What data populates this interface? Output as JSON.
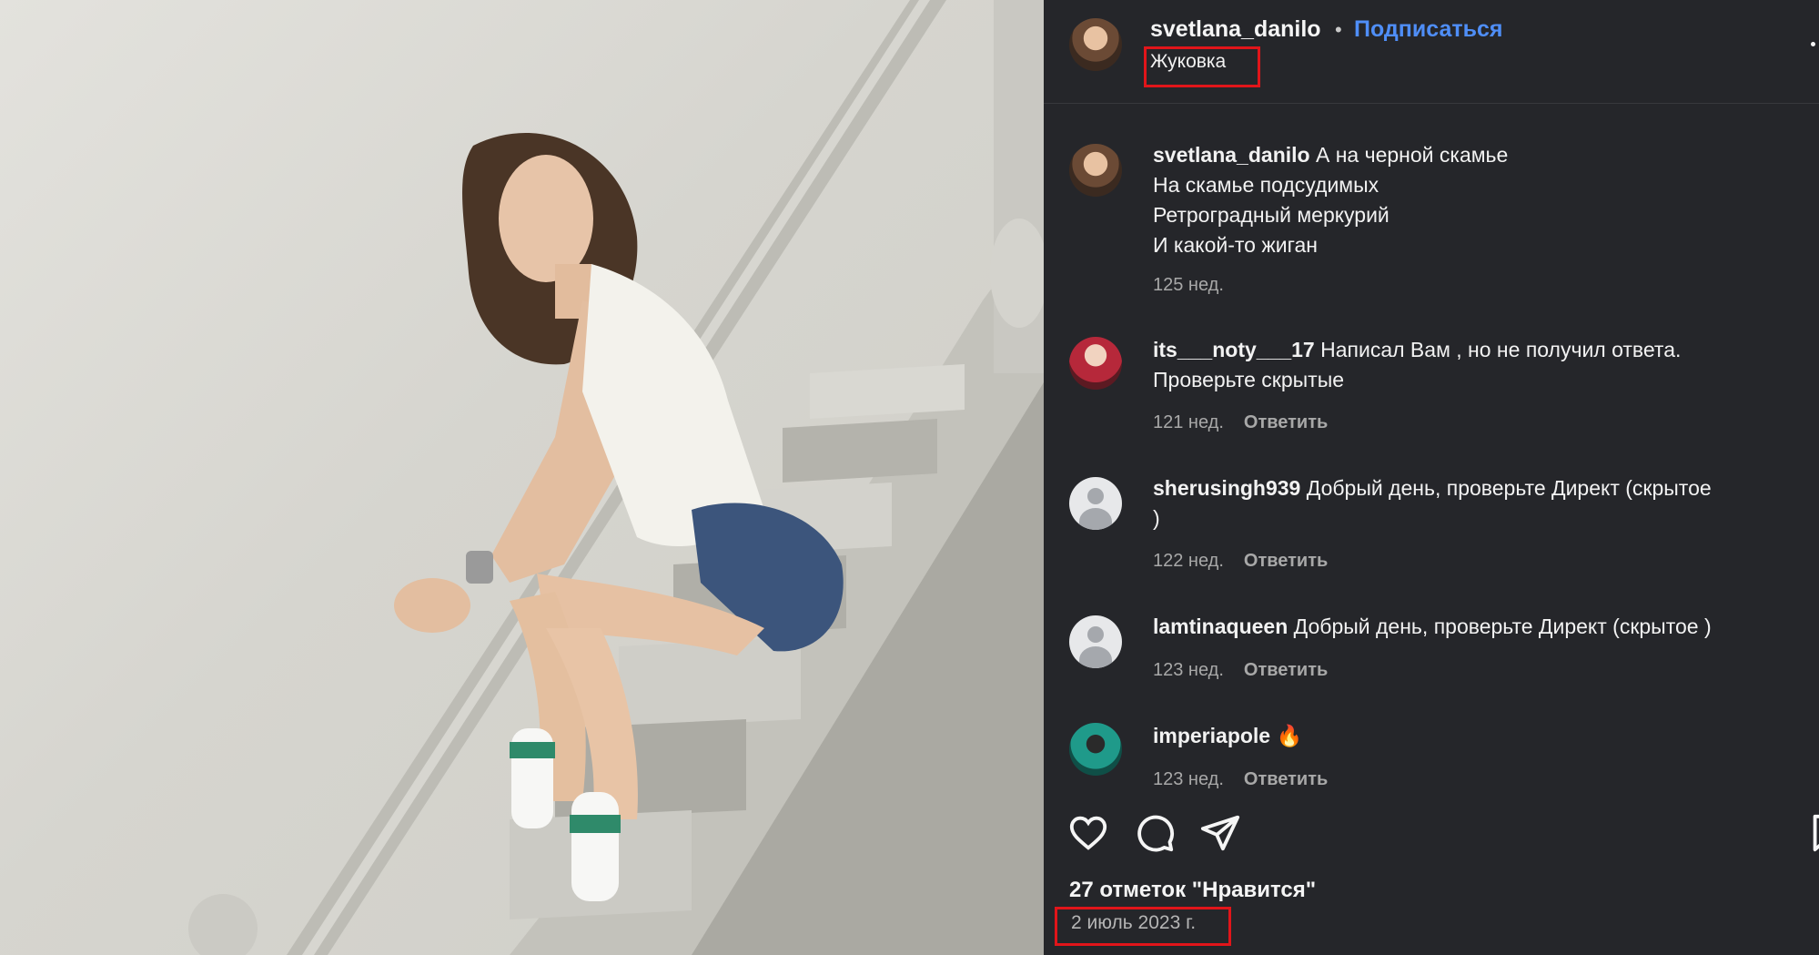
{
  "post": {
    "username": "svetlana_danilo",
    "separator": "•",
    "follow_label": "Подписаться",
    "location": "Жуковка",
    "likes": "27 отметок \"Нравится\"",
    "date": "2 июль 2023 г."
  },
  "comments": [
    {
      "user": "svetlana_danilo",
      "lines": [
        "А на черной скамье",
        "На скамье подсудимых",
        "Ретроградный меркурий",
        "И какой-то жиган"
      ],
      "time": "125 нед.",
      "reply": ""
    },
    {
      "user": "its___noty___17",
      "lines": [
        "Написал Вам , но не получил ответа.",
        "Проверьте скрытые"
      ],
      "time": "121 нед.",
      "reply": "Ответить"
    },
    {
      "user": "sherusingh939",
      "lines": [
        "Добрый день, проверьте Директ (скрытое",
        ")"
      ],
      "time": "122 нед.",
      "reply": "Ответить"
    },
    {
      "user": "lamtinaqueen",
      "lines": [
        "Добрый день, проверьте Директ (скрытое )"
      ],
      "time": "123 нед.",
      "reply": "Ответить"
    },
    {
      "user": "imperiapole",
      "lines": [
        "🔥"
      ],
      "time": "123 нед.",
      "reply": "Ответить"
    }
  ],
  "icons": [
    "heart-icon",
    "comment-icon",
    "share-icon",
    "bookmark-icon",
    "more-options-icon"
  ],
  "colors": {
    "panel_bg": "#25262a",
    "follow": "#4f8ef7",
    "highlight_box": "#e1151a"
  }
}
